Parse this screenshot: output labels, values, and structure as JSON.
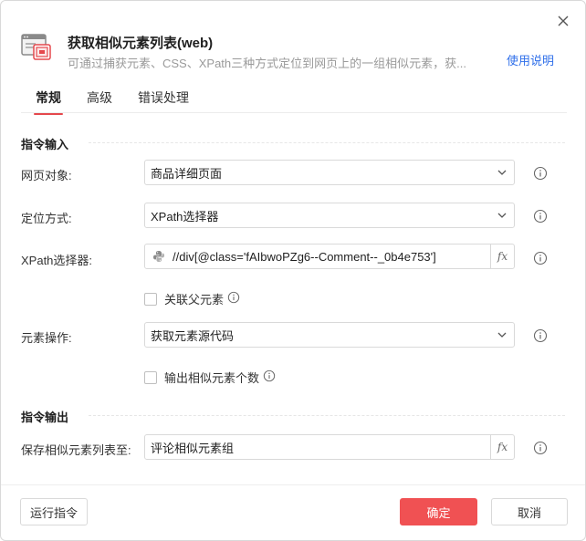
{
  "header": {
    "title": "获取相似元素列表(web)",
    "subtitle": "可通过捕获元素、CSS、XPath三种方式定位到网页上的一组相似元素，获...",
    "help_link": "使用说明"
  },
  "tabs": [
    {
      "label": "常规",
      "active": true
    },
    {
      "label": "高级",
      "active": false
    },
    {
      "label": "错误处理",
      "active": false
    }
  ],
  "sections": {
    "input": "指令输入",
    "output": "指令输出"
  },
  "fields": {
    "page_object": {
      "label": "网页对象:",
      "value": "商品详细页面"
    },
    "locate_method": {
      "label": "定位方式:",
      "value": "XPath选择器"
    },
    "xpath": {
      "label": "XPath选择器:",
      "value": "//div[@class='fAIbwoPZg6--Comment--_0b4e753']"
    },
    "related_parent": {
      "label": "关联父元素",
      "checked": false
    },
    "element_action": {
      "label": "元素操作:",
      "value": "获取元素源代码"
    },
    "output_count": {
      "label": "输出相似元素个数",
      "checked": false
    },
    "save_to": {
      "label": "保存相似元素列表至:",
      "value": "评论相似元素组"
    }
  },
  "footer": {
    "run_label": "运行指令",
    "ok_label": "确定",
    "cancel_label": "取消"
  },
  "colors": {
    "accent": "#e5484d",
    "primary_button": "#f05153",
    "link": "#2f6fea"
  },
  "icons": {
    "close": "close-icon",
    "app": "browser-window-icon",
    "chevron": "chevron-down-icon",
    "info": "info-circle-icon",
    "python": "python-icon",
    "fx": "fx-icon"
  }
}
